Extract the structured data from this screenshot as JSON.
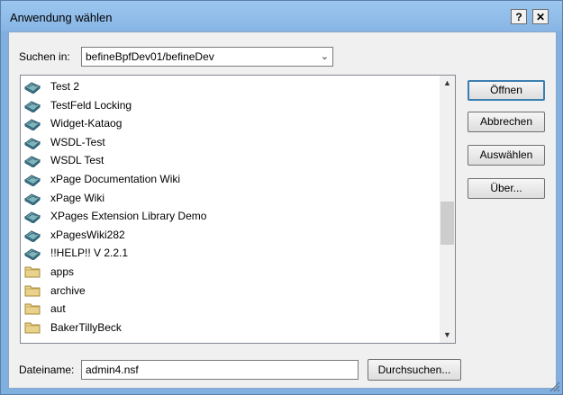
{
  "window": {
    "title": "Anwendung wählen",
    "help_label": "?",
    "close_label": "✕"
  },
  "search": {
    "label": "Suchen in:",
    "value": "befineBpfDev01/befineDev"
  },
  "list": {
    "items": [
      {
        "label": "Test 2",
        "icon": "database-icon"
      },
      {
        "label": "TestFeld Locking",
        "icon": "database-icon"
      },
      {
        "label": "Widget-Kataog",
        "icon": "database-icon"
      },
      {
        "label": "WSDL-Test",
        "icon": "database-icon"
      },
      {
        "label": "WSDL Test",
        "icon": "database-icon"
      },
      {
        "label": "xPage Documentation Wiki",
        "icon": "database-icon"
      },
      {
        "label": "xPage Wiki",
        "icon": "database-icon"
      },
      {
        "label": "XPages Extension Library Demo",
        "icon": "database-icon"
      },
      {
        "label": "xPagesWiki282",
        "icon": "database-icon"
      },
      {
        "label": "!!HELP!! V 2.2.1",
        "icon": "database-icon"
      },
      {
        "label": "apps",
        "icon": "folder-icon"
      },
      {
        "label": "archive",
        "icon": "folder-icon"
      },
      {
        "label": "aut",
        "icon": "folder-icon"
      },
      {
        "label": "BakerTillyBeck",
        "icon": "folder-icon"
      }
    ]
  },
  "buttons": {
    "open": "Öffnen",
    "cancel": "Abbrechen",
    "select": "Auswählen",
    "about": "Über..."
  },
  "filename": {
    "label": "Dateiname:",
    "value": "admin4.nsf",
    "browse": "Durchsuchen..."
  }
}
